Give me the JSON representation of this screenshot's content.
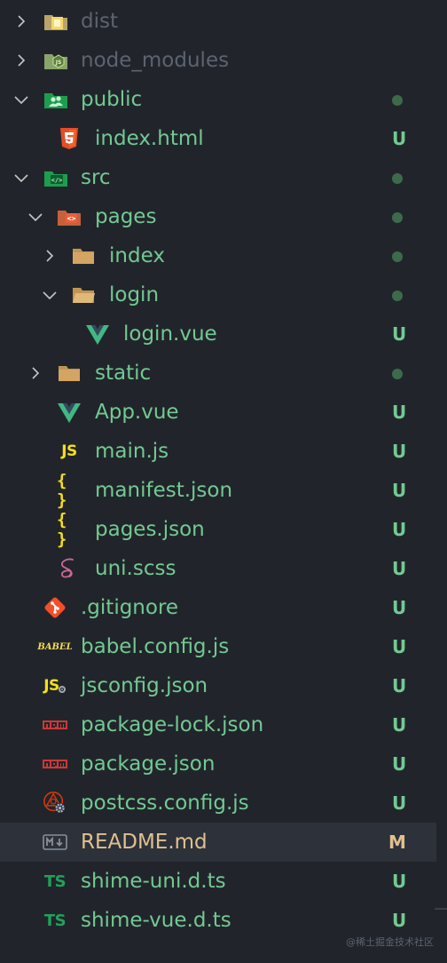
{
  "explorer": {
    "items": [
      {
        "label": "dist"
      },
      {
        "label": "node_modules"
      },
      {
        "label": "public"
      },
      {
        "label": "index.html",
        "status": "U"
      },
      {
        "label": "src"
      },
      {
        "label": "pages"
      },
      {
        "label": "index"
      },
      {
        "label": "login"
      },
      {
        "label": "login.vue",
        "status": "U"
      },
      {
        "label": "static"
      },
      {
        "label": "App.vue",
        "status": "U"
      },
      {
        "label": "main.js",
        "status": "U"
      },
      {
        "label": "manifest.json",
        "status": "U"
      },
      {
        "label": "pages.json",
        "status": "U"
      },
      {
        "label": "uni.scss",
        "status": "U"
      },
      {
        "label": ".gitignore",
        "status": "U"
      },
      {
        "label": "babel.config.js",
        "status": "U"
      },
      {
        "label": "jsconfig.json",
        "status": "U"
      },
      {
        "label": "package-lock.json",
        "status": "U"
      },
      {
        "label": "package.json",
        "status": "U"
      },
      {
        "label": "postcss.config.js",
        "status": "U"
      },
      {
        "label": "README.md",
        "status": "M"
      },
      {
        "label": "shime-uni.d.ts",
        "status": "U"
      },
      {
        "label": "shime-vue.d.ts",
        "status": "U"
      }
    ]
  },
  "icon_text": {
    "js": "JS",
    "braces": "{ }",
    "ts": "TS",
    "babel": "BABEL"
  },
  "watermark": "@稀土掘金技术社区",
  "colors": {
    "background": "#21252b",
    "selected_row": "#2c313a",
    "untracked": "#73c991",
    "modified": "#e2c08d",
    "ignored": "#5c6370",
    "dot": "#3d6b4a"
  }
}
